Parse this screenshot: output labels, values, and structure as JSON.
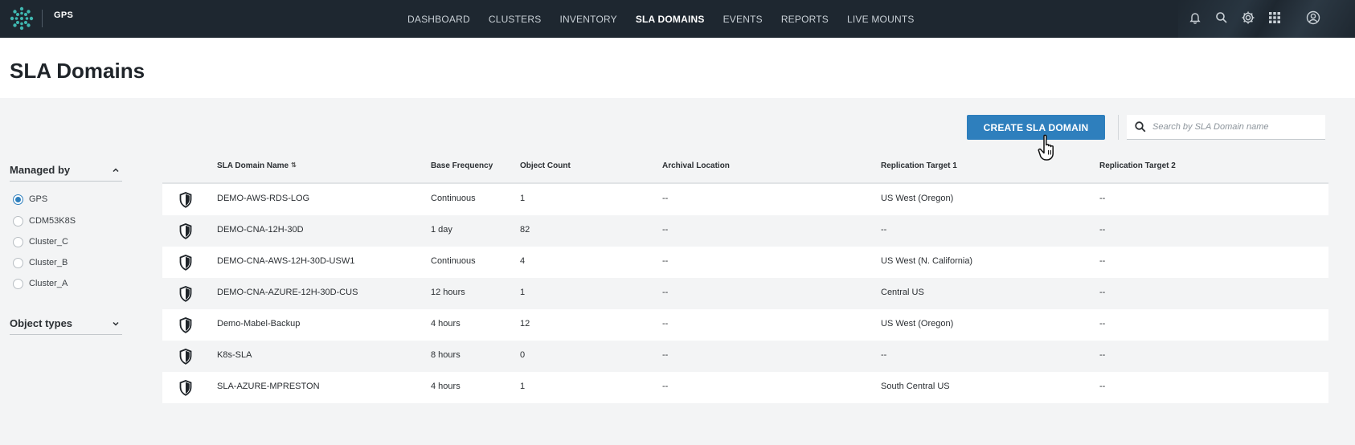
{
  "app": {
    "name": "GPS"
  },
  "nav": {
    "items": [
      "DASHBOARD",
      "CLUSTERS",
      "INVENTORY",
      "SLA DOMAINS",
      "EVENTS",
      "REPORTS",
      "LIVE MOUNTS"
    ],
    "active_index": 3
  },
  "top_icons": [
    "bell-icon",
    "search-icon",
    "gear-icon",
    "apps-grid-icon",
    "user-icon"
  ],
  "page": {
    "title": "SLA Domains"
  },
  "toolbar": {
    "create_label": "CREATE SLA DOMAIN",
    "search_placeholder": "Search by SLA Domain name",
    "search_value": ""
  },
  "filters": {
    "managed_by": {
      "title": "Managed by",
      "expanded": true,
      "options": [
        "GPS",
        "CDM53K8S",
        "Cluster_C",
        "Cluster_B",
        "Cluster_A"
      ],
      "selected": "GPS"
    },
    "object_types": {
      "title": "Object types",
      "expanded": false
    }
  },
  "table": {
    "columns": [
      "SLA Domain Name",
      "Base Frequency",
      "Object Count",
      "Archival Location",
      "Replication Target 1",
      "Replication Target 2"
    ],
    "rows": [
      [
        "DEMO-AWS-RDS-LOG",
        "Continuous",
        "1",
        "--",
        "US West (Oregon)",
        "--"
      ],
      [
        "DEMO-CNA-12H-30D",
        "1 day",
        "82",
        "--",
        "--",
        "--"
      ],
      [
        "DEMO-CNA-AWS-12H-30D-USW1",
        "Continuous",
        "4",
        "--",
        "US West (N. California)",
        "--"
      ],
      [
        "DEMO-CNA-AZURE-12H-30D-CUS",
        "12 hours",
        "1",
        "--",
        "Central US",
        "--"
      ],
      [
        "Demo-Mabel-Backup",
        "4 hours",
        "12",
        "--",
        "US West (Oregon)",
        "--"
      ],
      [
        "K8s-SLA",
        "8 hours",
        "0",
        "--",
        "--",
        "--"
      ],
      [
        "SLA-AZURE-MPRESTON",
        "4 hours",
        "1",
        "--",
        "South Central US",
        "--"
      ]
    ]
  },
  "colors": {
    "accent": "#2e7fbd",
    "topbar": "#1e2730"
  }
}
